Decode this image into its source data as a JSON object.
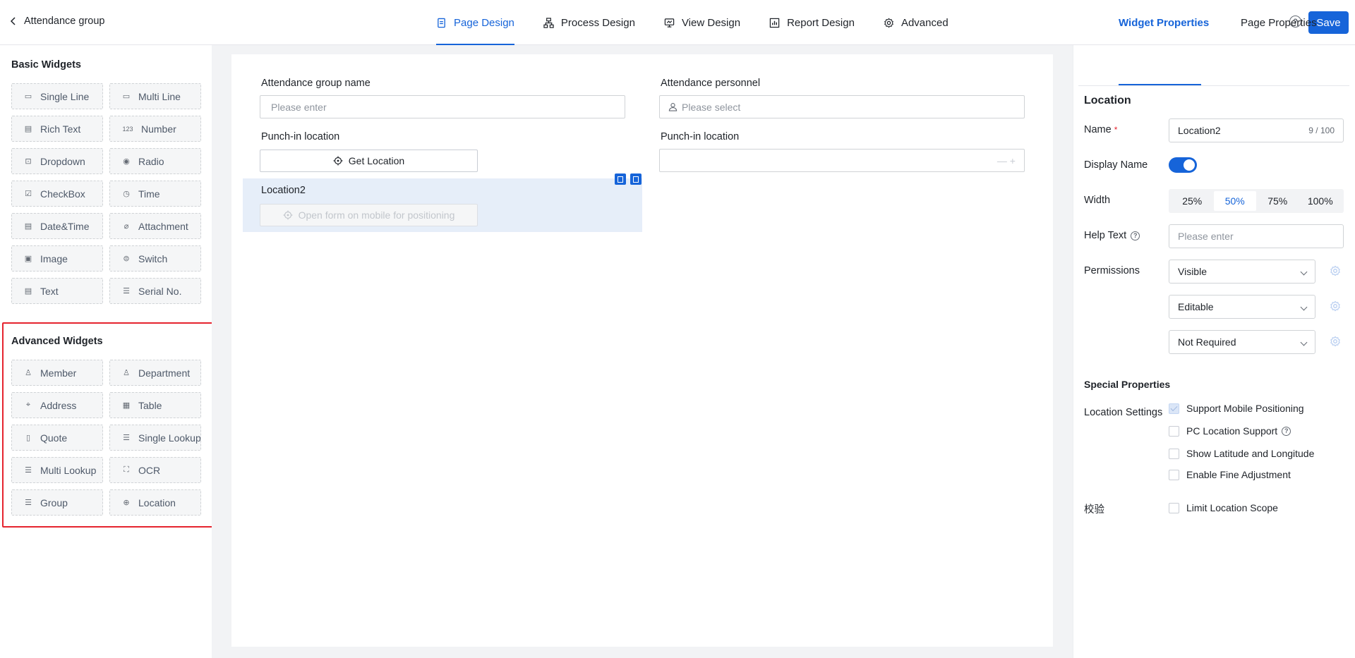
{
  "header": {
    "back_label": "Attendance group",
    "tabs": [
      {
        "label": "Page Design",
        "icon": "page-icon",
        "active": true
      },
      {
        "label": "Process Design",
        "icon": "flow-icon",
        "active": false
      },
      {
        "label": "View Design",
        "icon": "monitor-icon",
        "active": false
      },
      {
        "label": "Report Design",
        "icon": "chart-icon",
        "active": false
      },
      {
        "label": "Advanced",
        "icon": "gear-icon",
        "active": false
      }
    ],
    "help_label": "?",
    "save_label": "Save"
  },
  "left_panel": {
    "basic_title": "Basic Widgets",
    "basic": [
      {
        "label": "Single Line",
        "icon": "single-line-icon",
        "glyph": "▭"
      },
      {
        "label": "Multi Line",
        "icon": "multi-line-icon",
        "glyph": "▭"
      },
      {
        "label": "Rich Text",
        "icon": "rich-text-icon",
        "glyph": "▤"
      },
      {
        "label": "Number",
        "icon": "number-icon",
        "glyph": "123"
      },
      {
        "label": "Dropdown",
        "icon": "dropdown-icon",
        "glyph": "⊡"
      },
      {
        "label": "Radio",
        "icon": "radio-icon",
        "glyph": "◉"
      },
      {
        "label": "CheckBox",
        "icon": "checkbox-icon",
        "glyph": "☑"
      },
      {
        "label": "Time",
        "icon": "clock-icon",
        "glyph": "◷"
      },
      {
        "label": "Date&Time",
        "icon": "calendar-icon",
        "glyph": "▤"
      },
      {
        "label": "Attachment",
        "icon": "paperclip-icon",
        "glyph": "⌀"
      },
      {
        "label": "Image",
        "icon": "image-icon",
        "glyph": "▣"
      },
      {
        "label": "Switch",
        "icon": "switch-icon",
        "glyph": "⊜"
      },
      {
        "label": "Text",
        "icon": "text-icon",
        "glyph": "▤"
      },
      {
        "label": "Serial No.",
        "icon": "serial-icon",
        "glyph": "☰"
      }
    ],
    "advanced_title": "Advanced Widgets",
    "advanced": [
      {
        "label": "Member",
        "icon": "person-icon",
        "glyph": "♙"
      },
      {
        "label": "Department",
        "icon": "people-icon",
        "glyph": "♙"
      },
      {
        "label": "Address",
        "icon": "pin-icon",
        "glyph": "⌖"
      },
      {
        "label": "Table",
        "icon": "table-icon",
        "glyph": "▦"
      },
      {
        "label": "Quote",
        "icon": "document-icon",
        "glyph": "▯"
      },
      {
        "label": "Single Lookup",
        "icon": "list-icon",
        "glyph": "☰"
      },
      {
        "label": "Multi Lookup",
        "icon": "checklist-icon",
        "glyph": "☰"
      },
      {
        "label": "OCR",
        "icon": "scan-icon",
        "glyph": "⛶"
      },
      {
        "label": "Group",
        "icon": "group-icon",
        "glyph": "☰"
      },
      {
        "label": "Location",
        "icon": "crosshair-icon",
        "glyph": "⊕"
      }
    ]
  },
  "canvas": {
    "field1_label": "Attendance group name",
    "field1_placeholder": "Please enter",
    "field2_label": "Attendance personnel",
    "field2_placeholder": "Please select",
    "field3_label": "Punch-in location",
    "field3_button": "Get Location",
    "field4_label": "Punch-in location",
    "field4_stepper": "— +",
    "selected_label": "Location2",
    "selected_button": "Open form on mobile for positioning"
  },
  "right_panel": {
    "tabs": [
      "Widget Properties",
      "Page Properties"
    ],
    "title": "Location",
    "name_label": "Name",
    "required_mark": "*",
    "name_value": "Location2",
    "name_count": "9 / 100",
    "display_name_label": "Display Name",
    "display_name_on": true,
    "width_label": "Width",
    "width_options": [
      "25%",
      "50%",
      "75%",
      "100%"
    ],
    "width_selected": "50%",
    "help_text_label": "Help Text",
    "help_text_placeholder": "Please enter",
    "permissions_label": "Permissions",
    "permissions": [
      "Visible",
      "Editable",
      "Not Required"
    ],
    "special_title": "Special Properties",
    "location_settings_label": "Location Settings",
    "location_settings": [
      {
        "label": "Support Mobile Positioning",
        "checked": true
      },
      {
        "label": "PC Location Support",
        "checked": false,
        "help": true
      },
      {
        "label": "Show Latitude and Longitude",
        "checked": false
      },
      {
        "label": "Enable Fine Adjustment",
        "checked": false
      }
    ],
    "validation_label": "校验",
    "validation_option": "Limit Location Scope"
  },
  "colors": {
    "accent": "#1664d9",
    "highlight_border": "#e5232e",
    "selected_field_bg": "#e6eef9",
    "canvas_bg": "#f2f3f5"
  }
}
